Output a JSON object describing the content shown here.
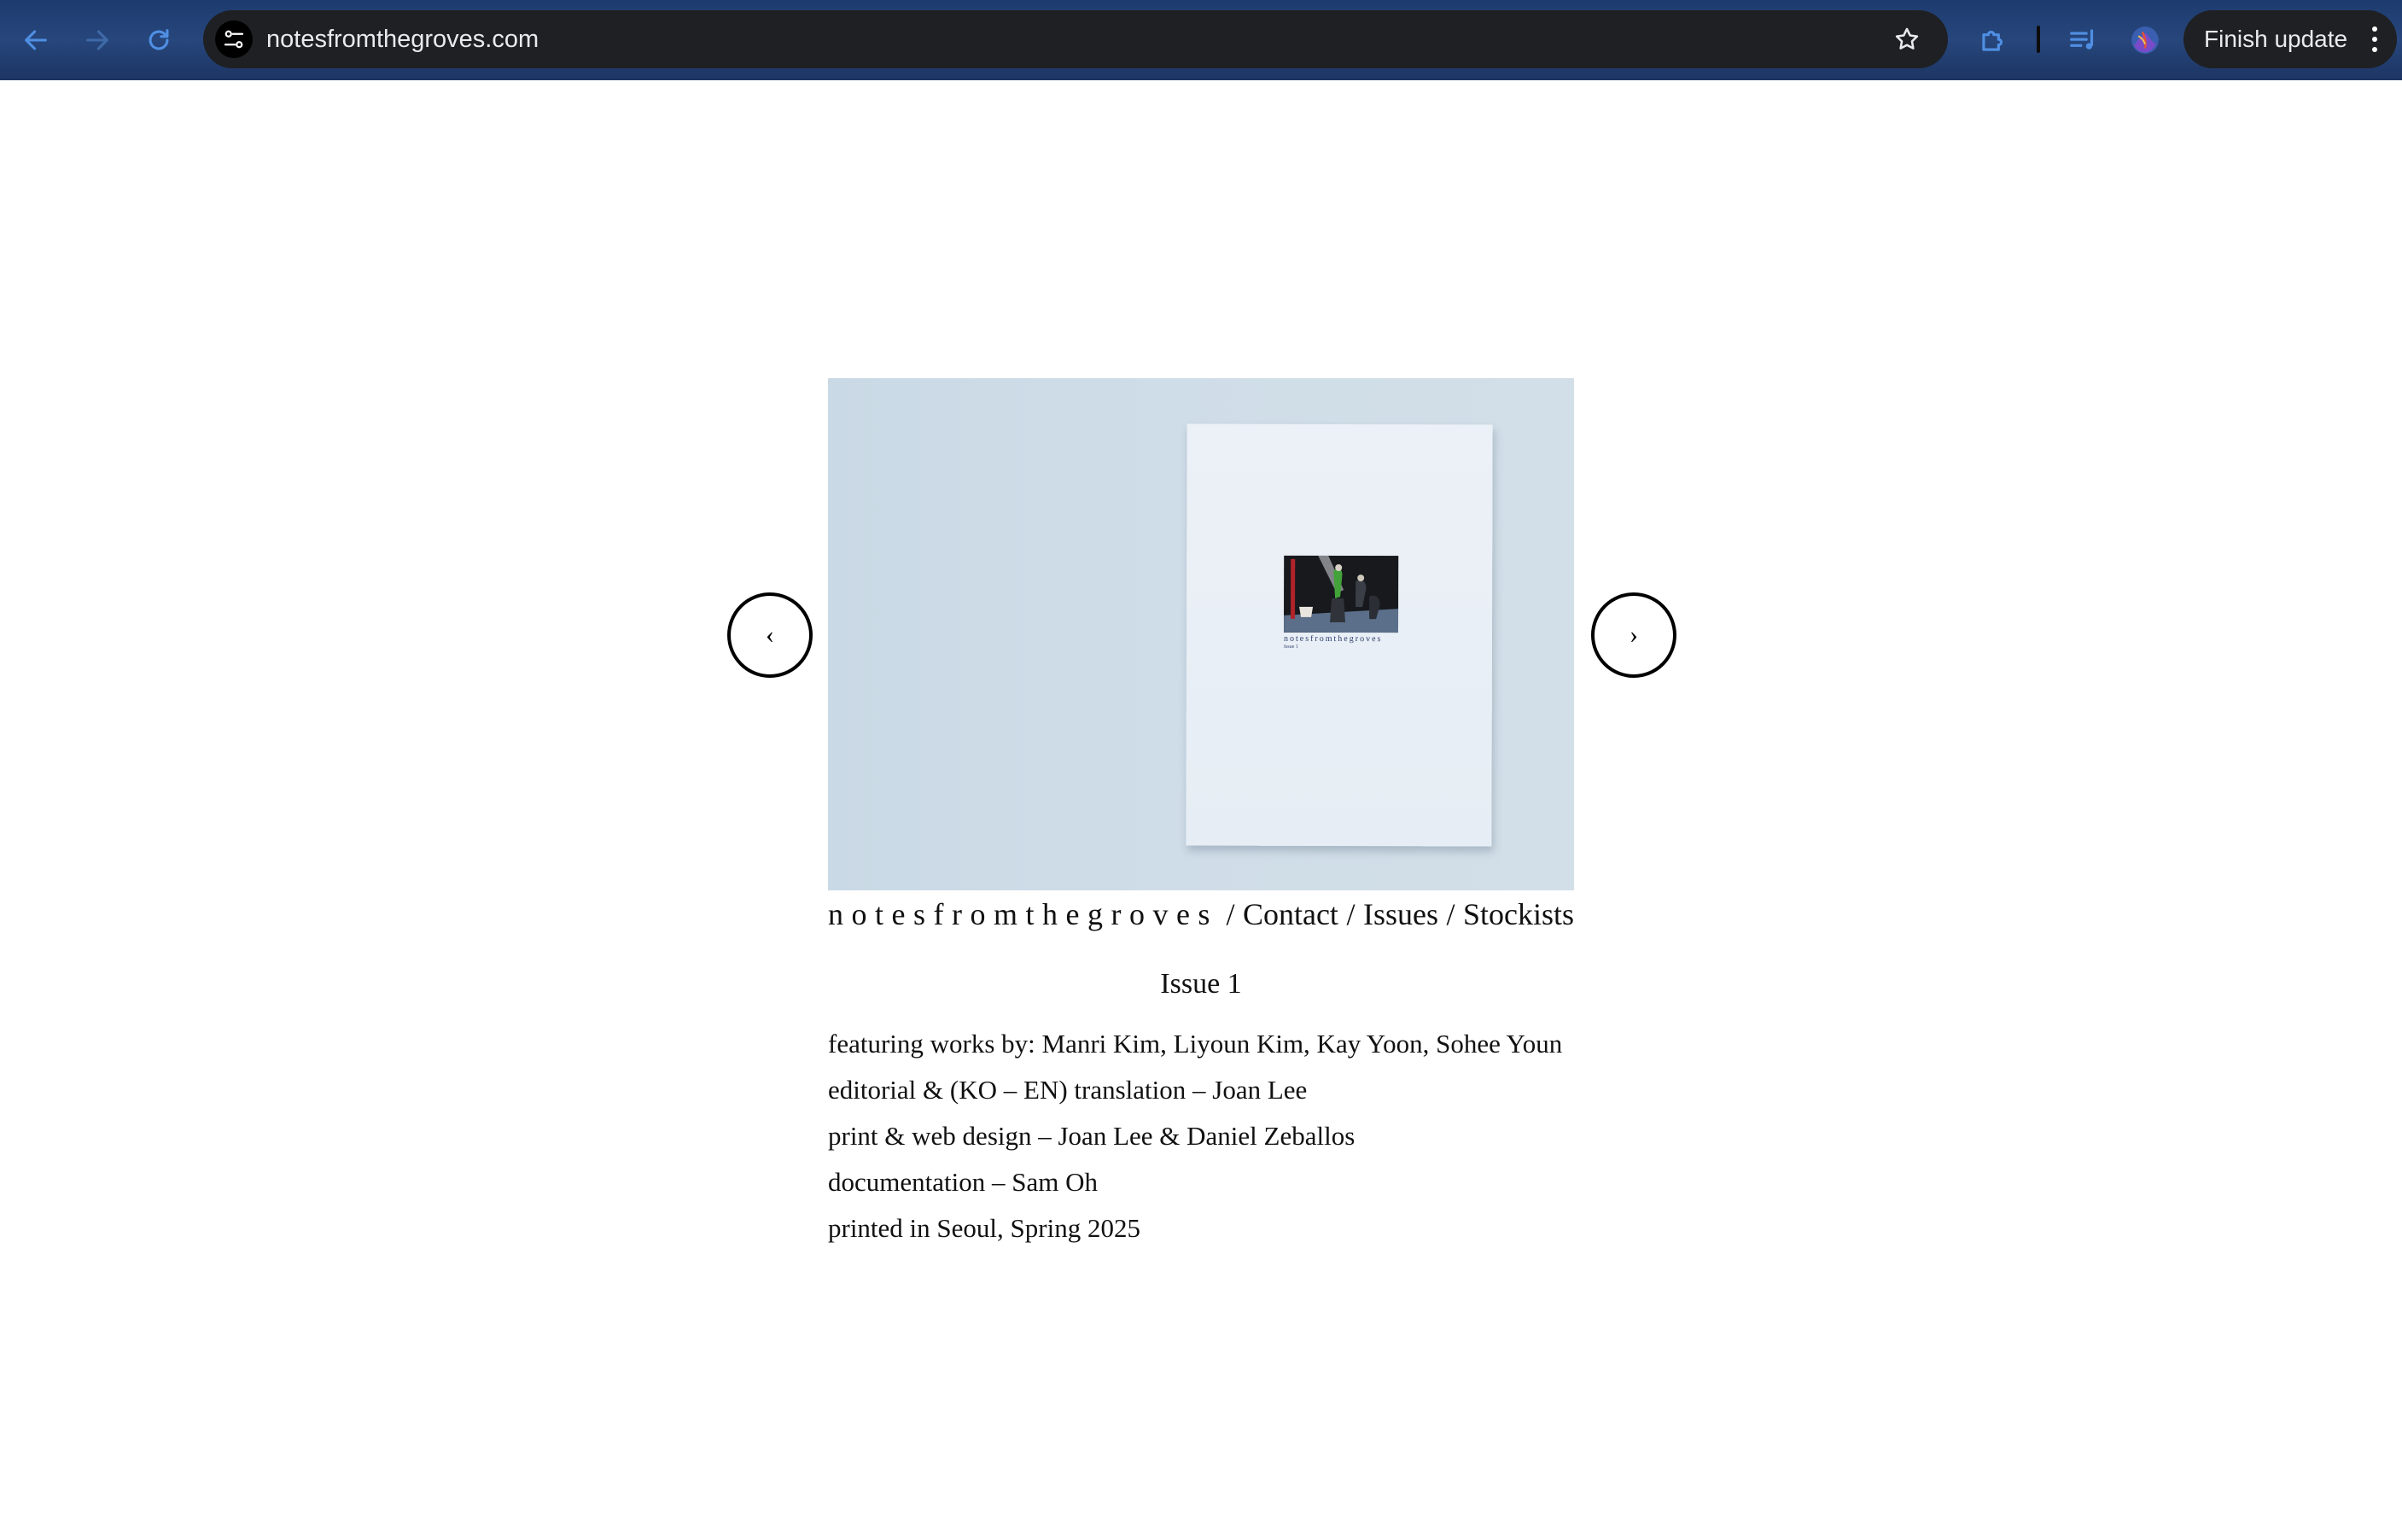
{
  "browser": {
    "url": "notesfromthegroves.com",
    "update_button_label": "Finish update",
    "icons": {
      "back": "arrow-left-icon",
      "forward": "arrow-right-icon",
      "reload": "reload-icon",
      "site_settings": "tune-icon",
      "bookmark": "star-icon",
      "extensions": "puzzle-icon",
      "media": "playlist-icon",
      "profile": "avatar-icon",
      "menu": "kebab-menu-icon"
    },
    "colors": {
      "toolbar": "#1d3b6e",
      "omnibox": "#1f2023",
      "accent_blue": "#4f8fe3"
    }
  },
  "carousel": {
    "prev_label": "‹",
    "next_label": "›",
    "cover_caption": "notesfromthegroves",
    "cover_issue": "Issue 1",
    "background_color": "#cddbe6"
  },
  "site_nav": {
    "brand": "notesfromthegroves",
    "separator": "/",
    "links": [
      "Contact",
      "Issues",
      "Stockists"
    ]
  },
  "issue": {
    "title": "Issue 1",
    "credits": [
      "featuring works by: Manri Kim, Liyoun Kim, Kay Yoon, Sohee Youn",
      "editorial & (KO – EN) translation – Joan Lee",
      "print & web design – Joan Lee & Daniel Zeballos",
      "documentation – Sam Oh",
      "printed in Seoul, Spring 2025"
    ]
  }
}
